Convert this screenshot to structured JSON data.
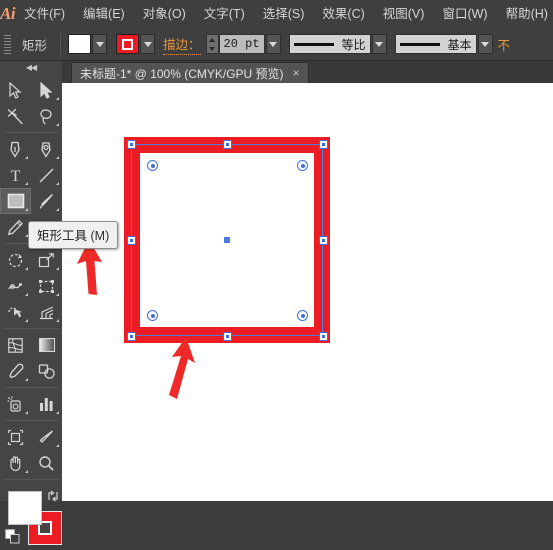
{
  "app": {
    "name": "Adobe Illustrator",
    "logo_text": "Ai"
  },
  "menubar": {
    "items": [
      {
        "label": "文件(F)",
        "name": "menu-file"
      },
      {
        "label": "编辑(E)",
        "name": "menu-edit"
      },
      {
        "label": "对象(O)",
        "name": "menu-object"
      },
      {
        "label": "文字(T)",
        "name": "menu-type"
      },
      {
        "label": "选择(S)",
        "name": "menu-select"
      },
      {
        "label": "效果(C)",
        "name": "menu-effect"
      },
      {
        "label": "视图(V)",
        "name": "menu-view"
      },
      {
        "label": "窗口(W)",
        "name": "menu-window"
      },
      {
        "label": "帮助(H)",
        "name": "menu-help"
      }
    ]
  },
  "controlbar": {
    "object_label": "矩形",
    "fill_swatch_color": "#ffffff",
    "stroke_swatch_color": "#ec1c24",
    "stroke_label": "描边：",
    "stroke_weight": "20 pt",
    "stroke_profile": "等比",
    "brush_definition": "基本",
    "opacity_label_cut": "不"
  },
  "tab": {
    "title": "未标题-1* @ 100% (CMYK/GPU 预览)",
    "close": "×"
  },
  "toolpanel": {
    "collapse": "◀◀",
    "tools": [
      {
        "name": "selection-tool",
        "label": "选择工具"
      },
      {
        "name": "direct-selection-tool",
        "label": "直接选择工具"
      },
      {
        "name": "magic-wand-tool",
        "label": "魔棒工具"
      },
      {
        "name": "lasso-tool",
        "label": "套索工具"
      },
      {
        "name": "pen-tool",
        "label": "钢笔工具"
      },
      {
        "name": "curvature-tool",
        "label": "曲率工具"
      },
      {
        "name": "type-tool",
        "label": "文字工具"
      },
      {
        "name": "line-segment-tool",
        "label": "直线段工具"
      },
      {
        "name": "rectangle-tool",
        "label": "矩形工具"
      },
      {
        "name": "paintbrush-tool",
        "label": "画笔工具"
      },
      {
        "name": "pencil-tool",
        "label": "铅笔工具"
      },
      {
        "name": "rotate-tool",
        "label": "旋转工具"
      },
      {
        "name": "scale-tool",
        "label": "比例缩放工具"
      },
      {
        "name": "width-tool",
        "label": "宽度工具"
      },
      {
        "name": "free-transform-tool",
        "label": "自由变换工具"
      },
      {
        "name": "shape-builder-tool",
        "label": "形状生成器工具"
      },
      {
        "name": "perspective-grid-tool",
        "label": "透视网格工具"
      },
      {
        "name": "mesh-tool",
        "label": "网格工具"
      },
      {
        "name": "gradient-tool",
        "label": "渐变工具"
      },
      {
        "name": "eyedropper-tool",
        "label": "吸管工具"
      },
      {
        "name": "blend-tool",
        "label": "混合工具"
      },
      {
        "name": "symbol-sprayer-tool",
        "label": "符号喷枪工具"
      },
      {
        "name": "column-graph-tool",
        "label": "柱形图工具"
      },
      {
        "name": "artboard-tool",
        "label": "画板工具"
      },
      {
        "name": "slice-tool",
        "label": "切片工具"
      },
      {
        "name": "hand-tool",
        "label": "抓手工具"
      },
      {
        "name": "zoom-tool",
        "label": "缩放工具"
      }
    ],
    "fill_color": "#ffffff",
    "stroke_color": "#ec1c24",
    "selected_tool": "rectangle-tool"
  },
  "tooltip": {
    "text": "矩形工具",
    "shortcut": "(M)"
  },
  "artwork": {
    "shape": "rectangle",
    "fill": "#ffffff",
    "stroke": "#ec1c24",
    "stroke_weight_px": 16,
    "selected": true,
    "handle_count": 8,
    "corner_widget_count": 4
  },
  "annotations": {
    "arrow_color": "#ee2a28",
    "arrows": [
      {
        "name": "arrow-to-tooltip",
        "points_to": "rectangle-tool-tooltip"
      },
      {
        "name": "arrow-to-shape",
        "points_to": "rectangle-bottom-stroke"
      }
    ]
  }
}
